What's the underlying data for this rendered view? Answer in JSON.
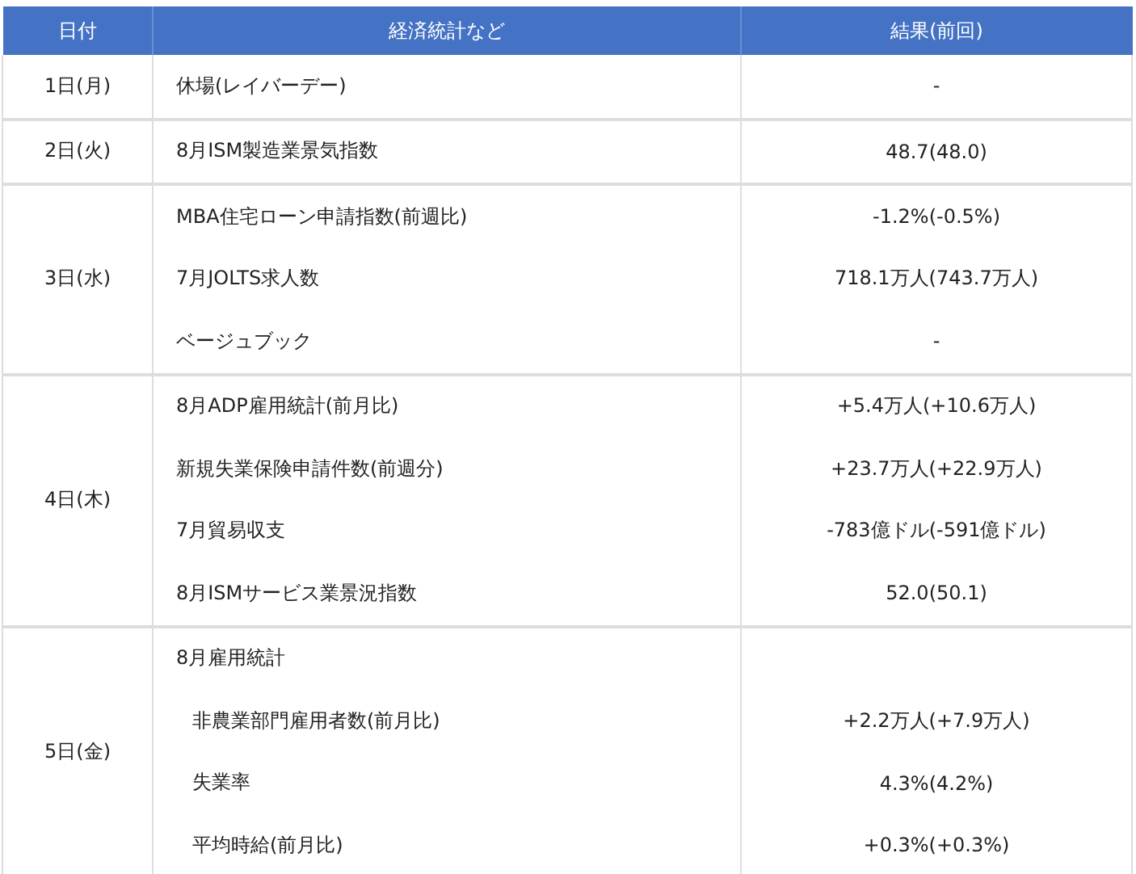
{
  "table": {
    "columns": [
      "日付",
      "経済統計など",
      "結果(前回)"
    ],
    "groups": [
      {
        "date": "1日(月)",
        "items": [
          {
            "event": "休場(レイバーデー)",
            "result": "-"
          }
        ]
      },
      {
        "date": "2日(火)",
        "items": [
          {
            "event": "8月ISM製造業景気指数",
            "result": "48.7(48.0)"
          }
        ]
      },
      {
        "date": "3日(水)",
        "items": [
          {
            "event": "MBA住宅ローン申請指数(前週比)",
            "result": "-1.2%(-0.5%)"
          },
          {
            "event": "7月JOLTS求人数",
            "result": "718.1万人(743.7万人)"
          },
          {
            "event": "ベージュブック",
            "result": "-"
          }
        ]
      },
      {
        "date": "4日(木)",
        "items": [
          {
            "event": "8月ADP雇用統計(前月比)",
            "result": "+5.4万人(+10.6万人)"
          },
          {
            "event": "新規失業保険申請件数(前週分)",
            "result": "+23.7万人(+22.9万人)"
          },
          {
            "event": "7月貿易収支",
            "result": "-783億ドル(-591億ドル)"
          },
          {
            "event": "8月ISMサービス業景況指数",
            "result": "52.0(50.1)"
          }
        ]
      },
      {
        "date": "5日(金)",
        "items": [
          {
            "event": "8月雇用統計",
            "children": [
              {
                "event": "非農業部門雇用者数(前月比)",
                "result": "+2.2万人(+7.9万人)"
              },
              {
                "event": "失業率",
                "result": "4.3%(4.2%)"
              },
              {
                "event": "平均時給(前月比)",
                "result": "+0.3%(+0.3%)"
              }
            ]
          }
        ]
      }
    ]
  }
}
